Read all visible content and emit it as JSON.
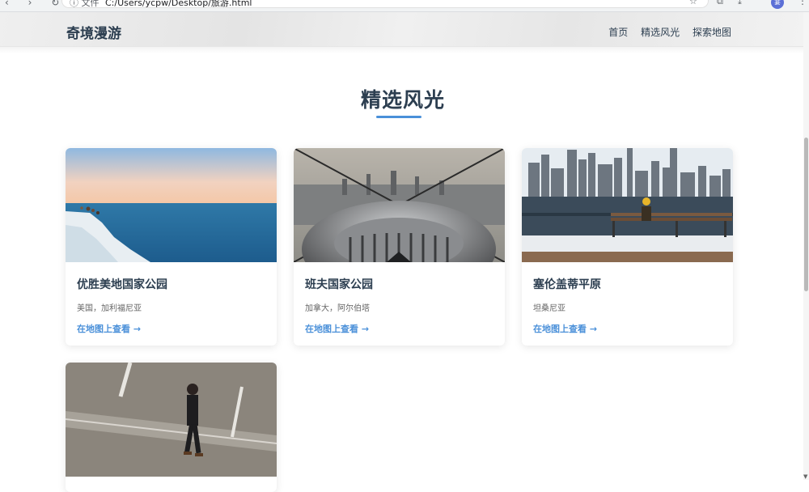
{
  "browser": {
    "nav_glyphs": "‹ › ↻",
    "security_label": "ⓘ 文件",
    "url": "C:/Users/ycpw/Desktop/旅游.html",
    "star_icon": "☆",
    "ext_icon": "⧉",
    "dl_icon": "⤓",
    "avatar_label": "宴",
    "menu_icon": "⋮"
  },
  "header": {
    "brand": "奇境漫游",
    "nav": [
      "首页",
      "精选风光",
      "探索地图"
    ]
  },
  "section": {
    "title": "精选风光"
  },
  "cards": [
    {
      "name": "优胜美地国家公园",
      "location": "美国，加利福尼亚",
      "link": "在地图上查看 →",
      "image": "sea-cliff-photo"
    },
    {
      "name": "班夫国家公园",
      "location": "加拿大，阿尔伯塔",
      "link": "在地图上查看 →",
      "image": "observatory-view-photo"
    },
    {
      "name": "塞伦盖蒂平原",
      "location": "坦桑尼亚",
      "link": "在地图上查看 →",
      "image": "city-skyline-bench-photo"
    },
    {
      "name": "",
      "location": "",
      "link": "",
      "image": "man-walking-street-photo"
    }
  ],
  "colors": {
    "brand_text": "#2c3e50",
    "accent": "#4a90d9"
  }
}
